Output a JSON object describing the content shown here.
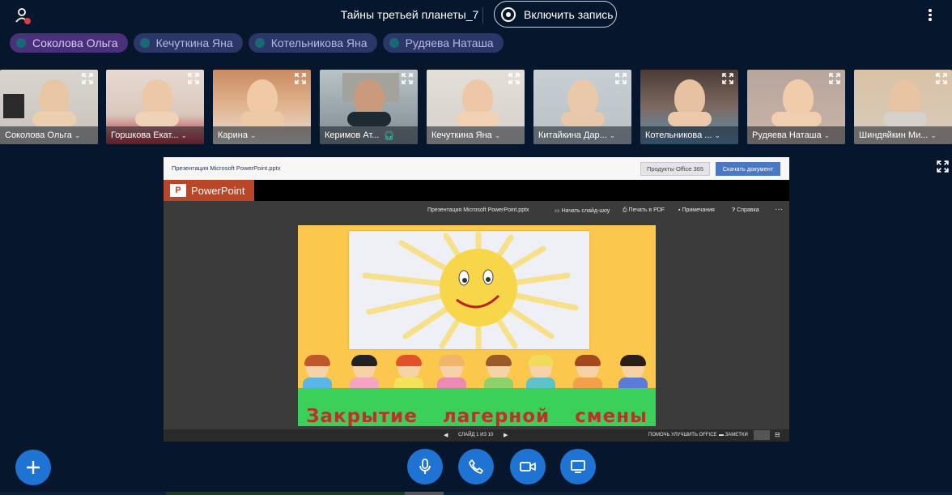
{
  "meeting": {
    "title": "Тайны третьей планеты_7",
    "record_label": "Включить запись"
  },
  "chips": [
    {
      "name": "Соколова Ольга",
      "active": true
    },
    {
      "name": "Кечуткина Яна",
      "active": false
    },
    {
      "name": "Котельникова Яна",
      "active": false
    },
    {
      "name": "Рудяева Наташа",
      "active": false
    }
  ],
  "tiles": [
    {
      "name": "Соколова Ольга"
    },
    {
      "name": "Горшкова Екат..."
    },
    {
      "name": "Карина"
    },
    {
      "name": "Керимов Ат..."
    },
    {
      "name": "Кечуткина Яна"
    },
    {
      "name": "Китайкина Дар..."
    },
    {
      "name": "Котельникова ..."
    },
    {
      "name": "Рудяева Наташа"
    },
    {
      "name": "Шиндяйкин Ми..."
    }
  ],
  "presentation": {
    "file_name": "Презентация Microsoft PowerPoint.pptx",
    "products_button": "Продукты Office 365",
    "download_button": "Скачать документ",
    "brand": "PowerPoint",
    "brand_icon": "P",
    "toolbar_file": "Презентация Microsoft PowerPoint.pptx",
    "toolbar": {
      "slideshow": "Начать слайд-шоу",
      "print_pdf": "Печать в PDF",
      "notes": "Примечания",
      "help": "Справка",
      "more": "···"
    },
    "slide_title": "Закрытие лагерной смены",
    "footer": {
      "slide_counter": "СЛАЙД 1 ИЗ 10",
      "improve": "ПОМОЧЬ УЛУЧШИТЬ OFFICE",
      "notes": "ЗАМЕТКИ"
    }
  },
  "controls": {
    "add_icon": "plus-icon",
    "mic_icon": "microphone-icon",
    "call_icon": "phone-icon",
    "camera_icon": "camera-icon",
    "screen_icon": "screen-share-icon",
    "accent": "#1e73d3"
  }
}
